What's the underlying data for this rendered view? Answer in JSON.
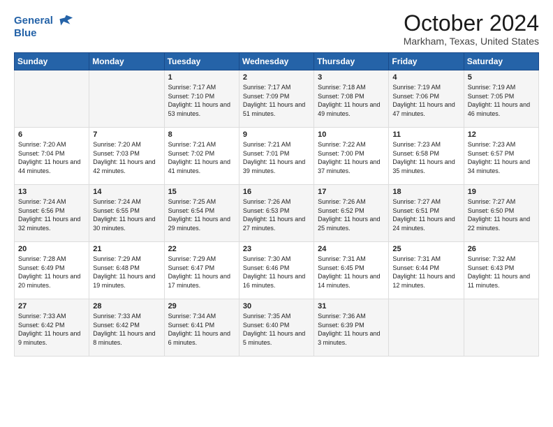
{
  "logo": {
    "line1": "General",
    "line2": "Blue"
  },
  "header": {
    "title": "October 2024",
    "location": "Markham, Texas, United States"
  },
  "weekdays": [
    "Sunday",
    "Monday",
    "Tuesday",
    "Wednesday",
    "Thursday",
    "Friday",
    "Saturday"
  ],
  "weeks": [
    [
      {
        "day": "",
        "text": ""
      },
      {
        "day": "",
        "text": ""
      },
      {
        "day": "1",
        "text": "Sunrise: 7:17 AM\nSunset: 7:10 PM\nDaylight: 11 hours and 53 minutes."
      },
      {
        "day": "2",
        "text": "Sunrise: 7:17 AM\nSunset: 7:09 PM\nDaylight: 11 hours and 51 minutes."
      },
      {
        "day": "3",
        "text": "Sunrise: 7:18 AM\nSunset: 7:08 PM\nDaylight: 11 hours and 49 minutes."
      },
      {
        "day": "4",
        "text": "Sunrise: 7:19 AM\nSunset: 7:06 PM\nDaylight: 11 hours and 47 minutes."
      },
      {
        "day": "5",
        "text": "Sunrise: 7:19 AM\nSunset: 7:05 PM\nDaylight: 11 hours and 46 minutes."
      }
    ],
    [
      {
        "day": "6",
        "text": "Sunrise: 7:20 AM\nSunset: 7:04 PM\nDaylight: 11 hours and 44 minutes."
      },
      {
        "day": "7",
        "text": "Sunrise: 7:20 AM\nSunset: 7:03 PM\nDaylight: 11 hours and 42 minutes."
      },
      {
        "day": "8",
        "text": "Sunrise: 7:21 AM\nSunset: 7:02 PM\nDaylight: 11 hours and 41 minutes."
      },
      {
        "day": "9",
        "text": "Sunrise: 7:21 AM\nSunset: 7:01 PM\nDaylight: 11 hours and 39 minutes."
      },
      {
        "day": "10",
        "text": "Sunrise: 7:22 AM\nSunset: 7:00 PM\nDaylight: 11 hours and 37 minutes."
      },
      {
        "day": "11",
        "text": "Sunrise: 7:23 AM\nSunset: 6:58 PM\nDaylight: 11 hours and 35 minutes."
      },
      {
        "day": "12",
        "text": "Sunrise: 7:23 AM\nSunset: 6:57 PM\nDaylight: 11 hours and 34 minutes."
      }
    ],
    [
      {
        "day": "13",
        "text": "Sunrise: 7:24 AM\nSunset: 6:56 PM\nDaylight: 11 hours and 32 minutes."
      },
      {
        "day": "14",
        "text": "Sunrise: 7:24 AM\nSunset: 6:55 PM\nDaylight: 11 hours and 30 minutes."
      },
      {
        "day": "15",
        "text": "Sunrise: 7:25 AM\nSunset: 6:54 PM\nDaylight: 11 hours and 29 minutes."
      },
      {
        "day": "16",
        "text": "Sunrise: 7:26 AM\nSunset: 6:53 PM\nDaylight: 11 hours and 27 minutes."
      },
      {
        "day": "17",
        "text": "Sunrise: 7:26 AM\nSunset: 6:52 PM\nDaylight: 11 hours and 25 minutes."
      },
      {
        "day": "18",
        "text": "Sunrise: 7:27 AM\nSunset: 6:51 PM\nDaylight: 11 hours and 24 minutes."
      },
      {
        "day": "19",
        "text": "Sunrise: 7:27 AM\nSunset: 6:50 PM\nDaylight: 11 hours and 22 minutes."
      }
    ],
    [
      {
        "day": "20",
        "text": "Sunrise: 7:28 AM\nSunset: 6:49 PM\nDaylight: 11 hours and 20 minutes."
      },
      {
        "day": "21",
        "text": "Sunrise: 7:29 AM\nSunset: 6:48 PM\nDaylight: 11 hours and 19 minutes."
      },
      {
        "day": "22",
        "text": "Sunrise: 7:29 AM\nSunset: 6:47 PM\nDaylight: 11 hours and 17 minutes."
      },
      {
        "day": "23",
        "text": "Sunrise: 7:30 AM\nSunset: 6:46 PM\nDaylight: 11 hours and 16 minutes."
      },
      {
        "day": "24",
        "text": "Sunrise: 7:31 AM\nSunset: 6:45 PM\nDaylight: 11 hours and 14 minutes."
      },
      {
        "day": "25",
        "text": "Sunrise: 7:31 AM\nSunset: 6:44 PM\nDaylight: 11 hours and 12 minutes."
      },
      {
        "day": "26",
        "text": "Sunrise: 7:32 AM\nSunset: 6:43 PM\nDaylight: 11 hours and 11 minutes."
      }
    ],
    [
      {
        "day": "27",
        "text": "Sunrise: 7:33 AM\nSunset: 6:42 PM\nDaylight: 11 hours and 9 minutes."
      },
      {
        "day": "28",
        "text": "Sunrise: 7:33 AM\nSunset: 6:42 PM\nDaylight: 11 hours and 8 minutes."
      },
      {
        "day": "29",
        "text": "Sunrise: 7:34 AM\nSunset: 6:41 PM\nDaylight: 11 hours and 6 minutes."
      },
      {
        "day": "30",
        "text": "Sunrise: 7:35 AM\nSunset: 6:40 PM\nDaylight: 11 hours and 5 minutes."
      },
      {
        "day": "31",
        "text": "Sunrise: 7:36 AM\nSunset: 6:39 PM\nDaylight: 11 hours and 3 minutes."
      },
      {
        "day": "",
        "text": ""
      },
      {
        "day": "",
        "text": ""
      }
    ]
  ]
}
